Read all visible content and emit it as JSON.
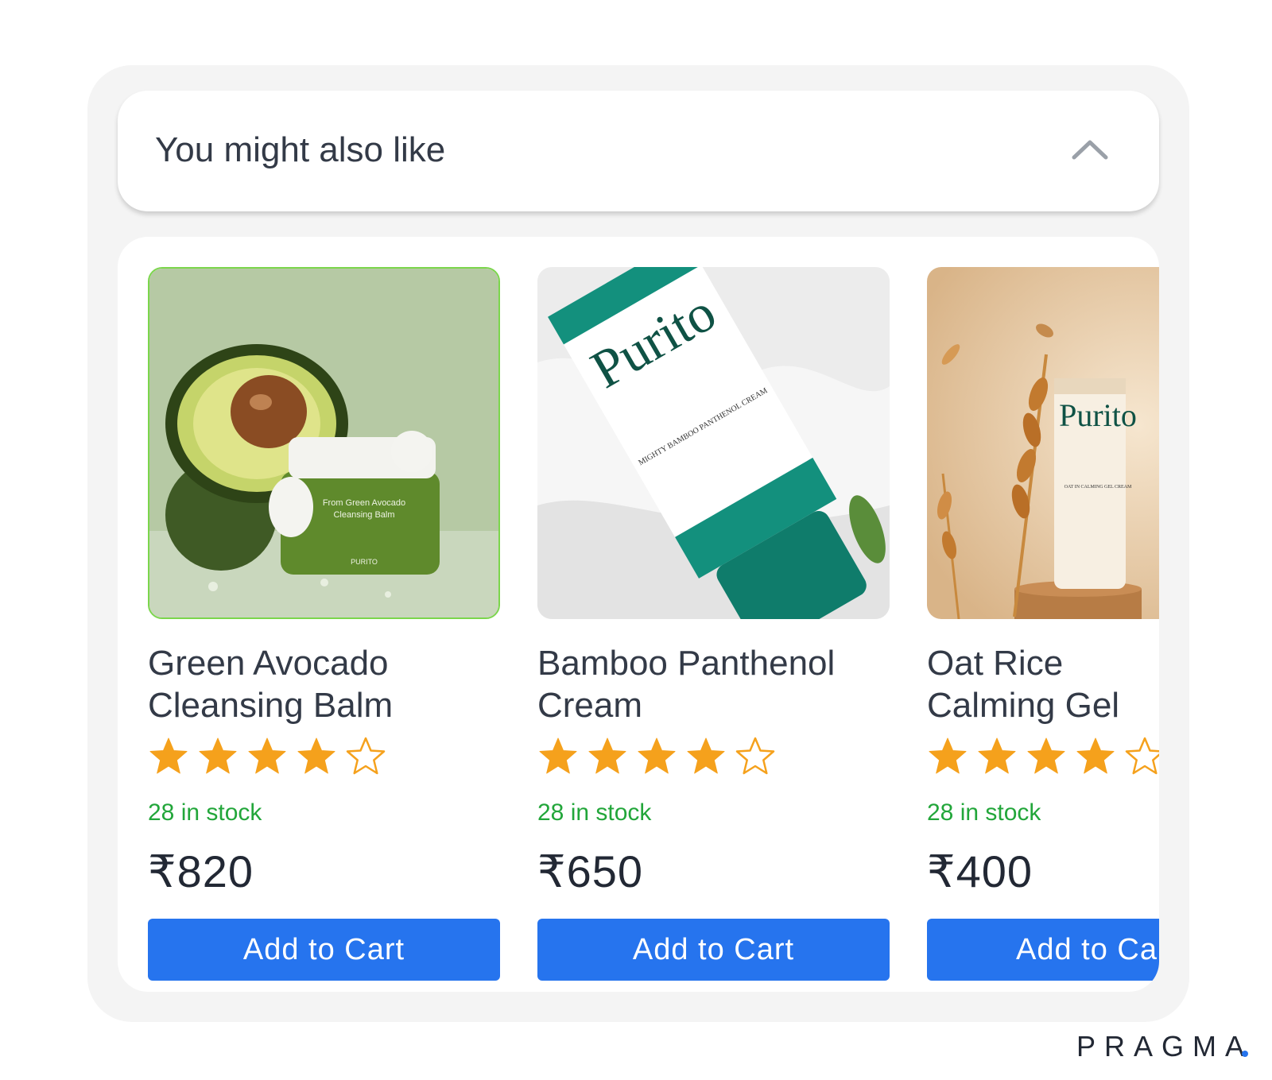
{
  "section": {
    "title": "You might also like",
    "collapse_icon": "chevron-up-icon"
  },
  "products": [
    {
      "name_line1": "Green Avocado",
      "name_line2": "Cleansing Balm",
      "rating": 4,
      "rating_max": 5,
      "stock": "28 in stock",
      "price": "₹820",
      "button": "Add to Cart",
      "image_label": "From Green Avocado",
      "image_label2": "Cleansing Balm",
      "image_brand": "PURITO"
    },
    {
      "name_line1": "Bamboo Panthenol",
      "name_line2": "Cream",
      "rating": 4,
      "rating_max": 5,
      "stock": "28 in stock",
      "price": "₹650",
      "button": "Add to Cart",
      "image_brand": "Purito",
      "image_label": "MIGHTY BAMBOO PANTHENOL CREAM"
    },
    {
      "name_line1": "Oat Rice",
      "name_line2": "Calming Gel",
      "rating": 4,
      "rating_max": 5,
      "stock": "28 in stock",
      "price": "₹400",
      "button": "Add to Cart",
      "image_brand": "Purito",
      "image_label": "OAT IN CALMING GEL CREAM"
    }
  ],
  "footer": {
    "brand": "PRAGMA"
  },
  "colors": {
    "accent": "#2674ee",
    "star": "#f5a11c",
    "stock": "#22a63a",
    "panel": "#f4f4f4"
  }
}
